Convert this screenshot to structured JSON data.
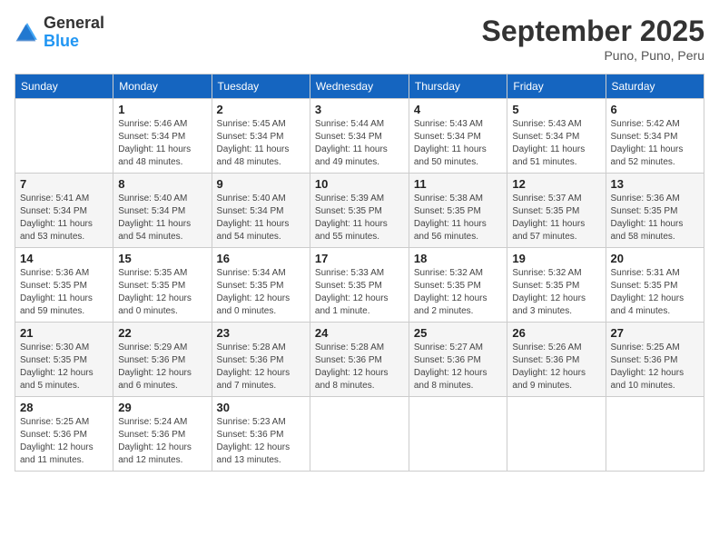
{
  "header": {
    "logo_general": "General",
    "logo_blue": "Blue",
    "month_year": "September 2025",
    "location": "Puno, Puno, Peru"
  },
  "days_of_week": [
    "Sunday",
    "Monday",
    "Tuesday",
    "Wednesday",
    "Thursday",
    "Friday",
    "Saturday"
  ],
  "weeks": [
    [
      {
        "day": "",
        "sunrise": "",
        "sunset": "",
        "daylight": ""
      },
      {
        "day": "1",
        "sunrise": "Sunrise: 5:46 AM",
        "sunset": "Sunset: 5:34 PM",
        "daylight": "Daylight: 11 hours and 48 minutes."
      },
      {
        "day": "2",
        "sunrise": "Sunrise: 5:45 AM",
        "sunset": "Sunset: 5:34 PM",
        "daylight": "Daylight: 11 hours and 48 minutes."
      },
      {
        "day": "3",
        "sunrise": "Sunrise: 5:44 AM",
        "sunset": "Sunset: 5:34 PM",
        "daylight": "Daylight: 11 hours and 49 minutes."
      },
      {
        "day": "4",
        "sunrise": "Sunrise: 5:43 AM",
        "sunset": "Sunset: 5:34 PM",
        "daylight": "Daylight: 11 hours and 50 minutes."
      },
      {
        "day": "5",
        "sunrise": "Sunrise: 5:43 AM",
        "sunset": "Sunset: 5:34 PM",
        "daylight": "Daylight: 11 hours and 51 minutes."
      },
      {
        "day": "6",
        "sunrise": "Sunrise: 5:42 AM",
        "sunset": "Sunset: 5:34 PM",
        "daylight": "Daylight: 11 hours and 52 minutes."
      }
    ],
    [
      {
        "day": "7",
        "sunrise": "Sunrise: 5:41 AM",
        "sunset": "Sunset: 5:34 PM",
        "daylight": "Daylight: 11 hours and 53 minutes."
      },
      {
        "day": "8",
        "sunrise": "Sunrise: 5:40 AM",
        "sunset": "Sunset: 5:34 PM",
        "daylight": "Daylight: 11 hours and 54 minutes."
      },
      {
        "day": "9",
        "sunrise": "Sunrise: 5:40 AM",
        "sunset": "Sunset: 5:34 PM",
        "daylight": "Daylight: 11 hours and 54 minutes."
      },
      {
        "day": "10",
        "sunrise": "Sunrise: 5:39 AM",
        "sunset": "Sunset: 5:35 PM",
        "daylight": "Daylight: 11 hours and 55 minutes."
      },
      {
        "day": "11",
        "sunrise": "Sunrise: 5:38 AM",
        "sunset": "Sunset: 5:35 PM",
        "daylight": "Daylight: 11 hours and 56 minutes."
      },
      {
        "day": "12",
        "sunrise": "Sunrise: 5:37 AM",
        "sunset": "Sunset: 5:35 PM",
        "daylight": "Daylight: 11 hours and 57 minutes."
      },
      {
        "day": "13",
        "sunrise": "Sunrise: 5:36 AM",
        "sunset": "Sunset: 5:35 PM",
        "daylight": "Daylight: 11 hours and 58 minutes."
      }
    ],
    [
      {
        "day": "14",
        "sunrise": "Sunrise: 5:36 AM",
        "sunset": "Sunset: 5:35 PM",
        "daylight": "Daylight: 11 hours and 59 minutes."
      },
      {
        "day": "15",
        "sunrise": "Sunrise: 5:35 AM",
        "sunset": "Sunset: 5:35 PM",
        "daylight": "Daylight: 12 hours and 0 minutes."
      },
      {
        "day": "16",
        "sunrise": "Sunrise: 5:34 AM",
        "sunset": "Sunset: 5:35 PM",
        "daylight": "Daylight: 12 hours and 0 minutes."
      },
      {
        "day": "17",
        "sunrise": "Sunrise: 5:33 AM",
        "sunset": "Sunset: 5:35 PM",
        "daylight": "Daylight: 12 hours and 1 minute."
      },
      {
        "day": "18",
        "sunrise": "Sunrise: 5:32 AM",
        "sunset": "Sunset: 5:35 PM",
        "daylight": "Daylight: 12 hours and 2 minutes."
      },
      {
        "day": "19",
        "sunrise": "Sunrise: 5:32 AM",
        "sunset": "Sunset: 5:35 PM",
        "daylight": "Daylight: 12 hours and 3 minutes."
      },
      {
        "day": "20",
        "sunrise": "Sunrise: 5:31 AM",
        "sunset": "Sunset: 5:35 PM",
        "daylight": "Daylight: 12 hours and 4 minutes."
      }
    ],
    [
      {
        "day": "21",
        "sunrise": "Sunrise: 5:30 AM",
        "sunset": "Sunset: 5:35 PM",
        "daylight": "Daylight: 12 hours and 5 minutes."
      },
      {
        "day": "22",
        "sunrise": "Sunrise: 5:29 AM",
        "sunset": "Sunset: 5:36 PM",
        "daylight": "Daylight: 12 hours and 6 minutes."
      },
      {
        "day": "23",
        "sunrise": "Sunrise: 5:28 AM",
        "sunset": "Sunset: 5:36 PM",
        "daylight": "Daylight: 12 hours and 7 minutes."
      },
      {
        "day": "24",
        "sunrise": "Sunrise: 5:28 AM",
        "sunset": "Sunset: 5:36 PM",
        "daylight": "Daylight: 12 hours and 8 minutes."
      },
      {
        "day": "25",
        "sunrise": "Sunrise: 5:27 AM",
        "sunset": "Sunset: 5:36 PM",
        "daylight": "Daylight: 12 hours and 8 minutes."
      },
      {
        "day": "26",
        "sunrise": "Sunrise: 5:26 AM",
        "sunset": "Sunset: 5:36 PM",
        "daylight": "Daylight: 12 hours and 9 minutes."
      },
      {
        "day": "27",
        "sunrise": "Sunrise: 5:25 AM",
        "sunset": "Sunset: 5:36 PM",
        "daylight": "Daylight: 12 hours and 10 minutes."
      }
    ],
    [
      {
        "day": "28",
        "sunrise": "Sunrise: 5:25 AM",
        "sunset": "Sunset: 5:36 PM",
        "daylight": "Daylight: 12 hours and 11 minutes."
      },
      {
        "day": "29",
        "sunrise": "Sunrise: 5:24 AM",
        "sunset": "Sunset: 5:36 PM",
        "daylight": "Daylight: 12 hours and 12 minutes."
      },
      {
        "day": "30",
        "sunrise": "Sunrise: 5:23 AM",
        "sunset": "Sunset: 5:36 PM",
        "daylight": "Daylight: 12 hours and 13 minutes."
      },
      {
        "day": "",
        "sunrise": "",
        "sunset": "",
        "daylight": ""
      },
      {
        "day": "",
        "sunrise": "",
        "sunset": "",
        "daylight": ""
      },
      {
        "day": "",
        "sunrise": "",
        "sunset": "",
        "daylight": ""
      },
      {
        "day": "",
        "sunrise": "",
        "sunset": "",
        "daylight": ""
      }
    ]
  ]
}
